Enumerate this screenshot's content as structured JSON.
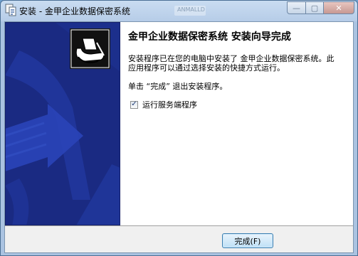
{
  "window": {
    "title": "安装 - 金甲企业数据保密系统",
    "ghost_text": "ANMALLD"
  },
  "controls": {
    "minimize": "—",
    "maximize": "▢",
    "close": "✕"
  },
  "content": {
    "heading": "金甲企业数据保密系统 安装向导完成",
    "paragraph1": "安装程序已在您的电脑中安装了 金甲企业数据保密系统。此应用程序可以通过选择安装的快捷方式运行。",
    "paragraph2": "单击 “完成” 退出安装程序。",
    "checkbox": {
      "label": "运行服务端程序",
      "checked": true,
      "mark": "✓"
    }
  },
  "buttons": {
    "finish": "完成(F)"
  },
  "colors": {
    "banner": "#1a2a82",
    "banner_accent": "#2a44b8"
  }
}
